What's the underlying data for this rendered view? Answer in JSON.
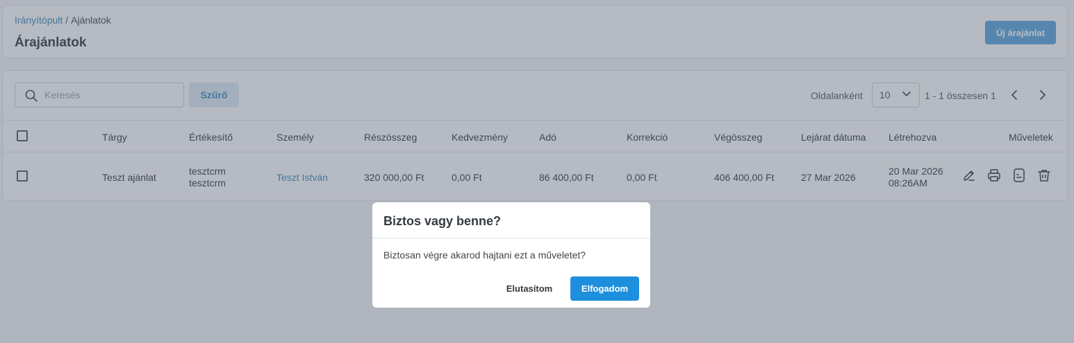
{
  "breadcrumb": {
    "root": "Irányítópult",
    "separator": "/",
    "current": "Ajánlatok"
  },
  "page": {
    "title": "Árajánlatok",
    "new_button": "Új árajánlat"
  },
  "toolbar": {
    "search_placeholder": "Keresés",
    "filter_button": "Szűrő",
    "per_page_label": "Oldalanként",
    "per_page_value": "10",
    "page_info": "1 - 1 összesen 1"
  },
  "table": {
    "columns": {
      "subject": "Tárgy",
      "seller": "Értékesítő",
      "person": "Személy",
      "subtotal": "Részösszeg",
      "discount": "Kedvezmény",
      "tax": "Adó",
      "correction": "Korrekció",
      "total": "Végösszeg",
      "expiry": "Lejárat dátuma",
      "created": "Létrehozva",
      "actions": "Műveletek"
    },
    "rows": [
      {
        "subject": "Teszt ajánlat",
        "seller_line1": "tesztcrm",
        "seller_line2": "tesztcrm",
        "person": "Teszt István",
        "subtotal": "320 000,00 Ft",
        "discount": "0,00 Ft",
        "tax": "86 400,00 Ft",
        "correction": "0,00 Ft",
        "total": "406 400,00 Ft",
        "expiry": "27 Mar 2026",
        "created_date": "20 Mar 2026",
        "created_time": "08:26AM"
      }
    ]
  },
  "modal": {
    "title": "Biztos vagy benne?",
    "message": "Biztosan végre akarod hajtani ezt a műveletet?",
    "reject_button": "Elutasítom",
    "accept_button": "Elfogadom"
  },
  "colors": {
    "accent": "#1e8fdc",
    "link": "#3c8dbc",
    "overlay": "rgba(80,90,110,0.42)"
  },
  "icons": [
    "search-icon",
    "chevron-down-icon",
    "chevron-left-icon",
    "chevron-right-icon",
    "edit-icon",
    "print-icon",
    "document-icon",
    "trash-icon"
  ]
}
